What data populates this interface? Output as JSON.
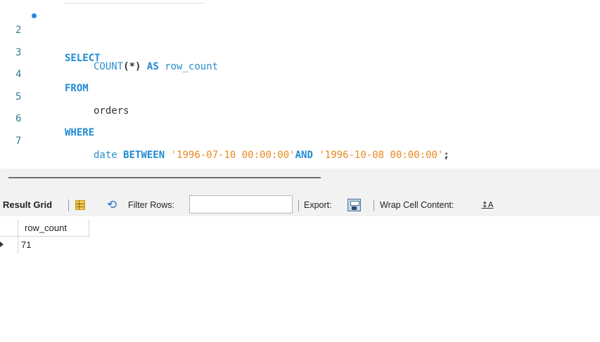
{
  "editor": {
    "lines": [
      {
        "num": "2",
        "has_marker": true
      },
      {
        "num": "3"
      },
      {
        "num": "4"
      },
      {
        "num": "5"
      },
      {
        "num": "6"
      },
      {
        "num": "7"
      }
    ],
    "kw_select": "SELECT",
    "fn_count": "COUNT",
    "count_args": "(*)",
    "kw_as": "AS",
    "alias": "row_count",
    "kw_from": "FROM",
    "table": "orders",
    "kw_where": "WHERE",
    "col_date": "date",
    "kw_between": "BETWEEN",
    "date_from": "'1996-07-10 00:00:00'",
    "kw_and": "AND",
    "date_to": "'1996-10-08 00:00:00'",
    "terminator": ";"
  },
  "toolbar": {
    "result_grid_label": "Result Grid",
    "filter_label": "Filter Rows:",
    "filter_value": "",
    "export_label": "Export:",
    "wrap_label": "Wrap Cell Content:",
    "wrap_icon_glyph": "↕A",
    "icons": [
      "grid-view-icon",
      "refresh-icon",
      "export-icon",
      "wrap-cell-icon"
    ]
  },
  "grid": {
    "columns": [
      "row_count"
    ],
    "rows": [
      [
        "71"
      ]
    ]
  },
  "colors": {
    "keyword": "#1f8bd3",
    "string": "#e88a20",
    "line_number": "#3a7a95",
    "marker": "#1e88e5",
    "panel_bg": "#f2f2f2"
  }
}
